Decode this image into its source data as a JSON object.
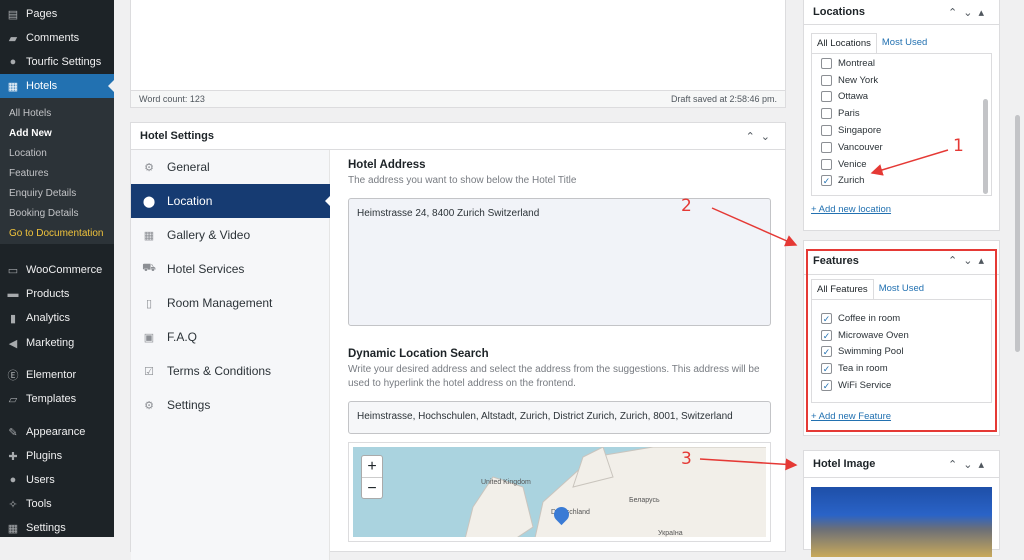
{
  "sidebar": {
    "items": [
      {
        "label": "Pages",
        "icon": "pages-icon"
      },
      {
        "label": "Comments",
        "icon": "comments-icon"
      },
      {
        "label": "Tourfic Settings",
        "icon": "tourfic-icon"
      },
      {
        "label": "Hotels",
        "icon": "hotels-icon"
      },
      {
        "label": "WooCommerce",
        "icon": "woo-icon"
      },
      {
        "label": "Products",
        "icon": "products-icon"
      },
      {
        "label": "Analytics",
        "icon": "analytics-icon"
      },
      {
        "label": "Marketing",
        "icon": "marketing-icon"
      },
      {
        "label": "Elementor",
        "icon": "elementor-icon"
      },
      {
        "label": "Templates",
        "icon": "templates-icon"
      },
      {
        "label": "Appearance",
        "icon": "appearance-icon"
      },
      {
        "label": "Plugins",
        "icon": "plugins-icon"
      },
      {
        "label": "Users",
        "icon": "users-icon"
      },
      {
        "label": "Tools",
        "icon": "tools-icon"
      },
      {
        "label": "Settings",
        "icon": "settings-icon"
      }
    ],
    "submenu": [
      "All Hotels",
      "Add New",
      "Location",
      "Features",
      "Enquiry Details",
      "Booking Details",
      "Go to Documentation"
    ]
  },
  "editor": {
    "word_count": "Word count: 123",
    "draft_saved": "Draft saved at 2:58:46 pm."
  },
  "hotel_settings": {
    "title": "Hotel Settings",
    "nav": [
      "General",
      "Location",
      "Gallery & Video",
      "Hotel Services",
      "Room Management",
      "F.A.Q",
      "Terms & Conditions",
      "Settings"
    ],
    "address_label": "Hotel Address",
    "address_desc": "The address you want to show below the Hotel Title",
    "address_value": "Heimstrasse 24, 8400 Zurich Switzerland",
    "dyn_label": "Dynamic Location Search",
    "dyn_desc": "Write your desired address and select the address from the suggestions. This address will be used to hyperlink the hotel address on the frontend.",
    "dyn_value": "Heimstrasse, Hochschulen, Altstadt, Zurich, District Zurich, Zurich, 8001, Switzerland",
    "map": {
      "zoom_in": "+",
      "zoom_out": "−",
      "labels": [
        "United Kingdom",
        "Deutschland",
        "Беларусь",
        "Україна"
      ]
    }
  },
  "locations": {
    "title": "Locations",
    "tab_all": "All Locations",
    "tab_used": "Most Used",
    "items": [
      {
        "name": "Montreal",
        "checked": false
      },
      {
        "name": "New York",
        "checked": false
      },
      {
        "name": "Ottawa",
        "checked": false
      },
      {
        "name": "Paris",
        "checked": false
      },
      {
        "name": "Singapore",
        "checked": false
      },
      {
        "name": "Vancouver",
        "checked": false
      },
      {
        "name": "Venice",
        "checked": false
      },
      {
        "name": "Zurich",
        "checked": true
      }
    ],
    "add": "+ Add new location"
  },
  "features": {
    "title": "Features",
    "tab_all": "All Features",
    "tab_used": "Most Used",
    "items": [
      {
        "name": "Coffee in room",
        "checked": true
      },
      {
        "name": "Microwave Oven",
        "checked": true
      },
      {
        "name": "Swimming Pool",
        "checked": true
      },
      {
        "name": "Tea in room",
        "checked": true
      },
      {
        "name": "WiFi Service",
        "checked": true
      }
    ],
    "add": "+ Add new Feature"
  },
  "hotel_image": {
    "title": "Hotel Image"
  },
  "annotations": [
    "1",
    "2",
    "3"
  ],
  "colors": {
    "sidebar": "#1d2327",
    "active": "#2271b1",
    "nav_active": "#163b72",
    "highlight": "#e53935"
  }
}
